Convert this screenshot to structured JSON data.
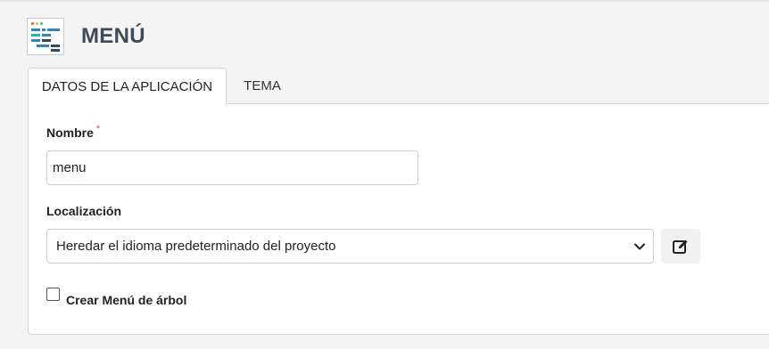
{
  "header": {
    "title": "MENÚ",
    "icon": "menu-app-icon"
  },
  "tabs": [
    {
      "label": "DATOS DE LA APLICACIÓN",
      "active": true
    },
    {
      "label": "TEMA",
      "active": false
    }
  ],
  "form": {
    "name": {
      "label": "Nombre",
      "required_mark": "*",
      "value": "menu"
    },
    "locale": {
      "label": "Localización",
      "selected": "Heredar el idioma predeterminado del proyecto",
      "edit_icon": "edit-icon"
    },
    "tree_menu": {
      "label": "Crear Menú de árbol",
      "checked": false
    }
  },
  "colors": {
    "title": "#3c4a5a",
    "required": "#d9534f",
    "icon_blue": "#2e86c1",
    "icon_dark": "#34495e",
    "icon_teal": "#1abc9c"
  }
}
